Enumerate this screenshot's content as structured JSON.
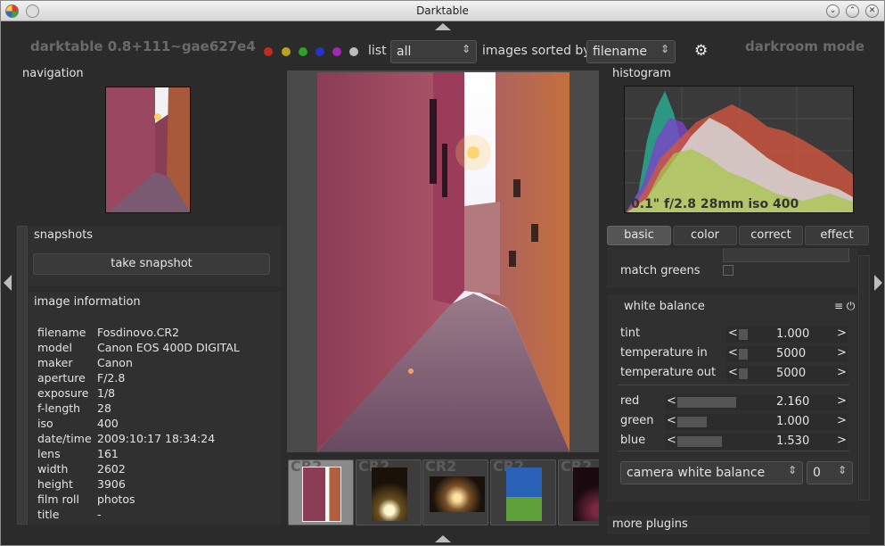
{
  "window": {
    "title": "Darktable"
  },
  "header": {
    "app_name": "darktable 0.8+111~gae627e4",
    "mode": "darkroom mode",
    "color_labels": [
      {
        "name": "red",
        "color": "#c42a1e"
      },
      {
        "name": "yellow",
        "color": "#b9a21d"
      },
      {
        "name": "green",
        "color": "#2ea12a"
      },
      {
        "name": "blue",
        "color": "#2433c9"
      },
      {
        "name": "purple",
        "color": "#a625b5"
      },
      {
        "name": "gray",
        "color": "#bcbcbc"
      }
    ],
    "list_label": "list",
    "list_value": "all",
    "sorted_label": "images sorted by",
    "sorted_value": "filename"
  },
  "left": {
    "navigation_title": "navigation",
    "snapshots_title": "snapshots",
    "take_snapshot_label": "take snapshot",
    "image_info_title": "image information",
    "image_info": [
      {
        "key": "filename",
        "value": "Fosdinovo.CR2"
      },
      {
        "key": "model",
        "value": "Canon EOS 400D DIGITAL"
      },
      {
        "key": "maker",
        "value": "Canon"
      },
      {
        "key": "aperture",
        "value": "F/2.8"
      },
      {
        "key": "exposure",
        "value": "1/8"
      },
      {
        "key": "f-length",
        "value": "28"
      },
      {
        "key": "iso",
        "value": "400"
      },
      {
        "key": "date/time",
        "value": "2009:10:17 18:34:24"
      },
      {
        "key": "lens",
        "value": "161"
      },
      {
        "key": "width",
        "value": "2602"
      },
      {
        "key": "height",
        "value": "3906"
      },
      {
        "key": "film roll",
        "value": "photos"
      },
      {
        "key": "title",
        "value": "-"
      }
    ]
  },
  "filmstrip": {
    "items": [
      {
        "ext": "CR2",
        "selected": true
      },
      {
        "ext": "CR2",
        "selected": false
      },
      {
        "ext": "CR2",
        "selected": false
      },
      {
        "ext": "CR2",
        "selected": false
      },
      {
        "ext": "CR2",
        "selected": false
      }
    ]
  },
  "right": {
    "histogram_title": "histogram",
    "histogram_caption": "0.1\" f/2.8 28mm iso 400",
    "tabs": [
      "basic",
      "color",
      "correct",
      "effect"
    ],
    "active_tab": "basic",
    "match_greens_label": "match greens",
    "white_balance_title": "white balance",
    "white_balance_icons": "≡ ⏻",
    "sliders": [
      {
        "label": "tint",
        "value": "1.000",
        "fill": 0.1
      },
      {
        "label": "temperature in",
        "value": "5000",
        "fill": 0.1
      },
      {
        "label": "temperature out",
        "value": "5000",
        "fill": 0.1
      },
      {
        "label": "red",
        "value": "2.160",
        "fill": 0.4
      },
      {
        "label": "green",
        "value": "1.000",
        "fill": 0.2
      },
      {
        "label": "blue",
        "value": "1.530",
        "fill": 0.3
      }
    ],
    "preset_value": "camera white balance",
    "preset_number": "0",
    "more_plugins_label": "more plugins"
  }
}
